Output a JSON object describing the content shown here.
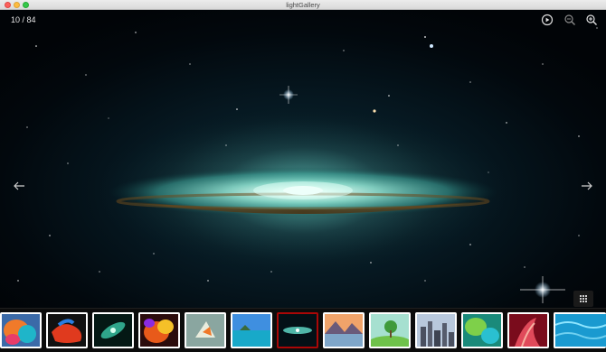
{
  "window": {
    "title": "lightGallery"
  },
  "gallery": {
    "counter": "10 / 84",
    "current": 10,
    "total": 84,
    "active_thumbnail": 7
  },
  "toolbar": {
    "icons": [
      "play-icon",
      "zoom-out-icon",
      "zoom-in-icon"
    ]
  },
  "navigation": {
    "prev_icon": "arrow-left-icon",
    "next_icon": "arrow-right-icon",
    "thumbnails_toggle_icon": "grid-icon"
  },
  "thumbnails": [
    {
      "name": "thumbnail-1"
    },
    {
      "name": "thumbnail-2"
    },
    {
      "name": "thumbnail-3"
    },
    {
      "name": "thumbnail-4"
    },
    {
      "name": "thumbnail-5"
    },
    {
      "name": "thumbnail-6"
    },
    {
      "name": "thumbnail-7"
    },
    {
      "name": "thumbnail-8"
    },
    {
      "name": "thumbnail-9"
    },
    {
      "name": "thumbnail-10"
    },
    {
      "name": "thumbnail-11"
    },
    {
      "name": "thumbnail-12"
    },
    {
      "name": "thumbnail-13"
    }
  ],
  "colors": {
    "active_border": "#a90707",
    "thumb_border": "#ffffff",
    "background": "#000000"
  }
}
